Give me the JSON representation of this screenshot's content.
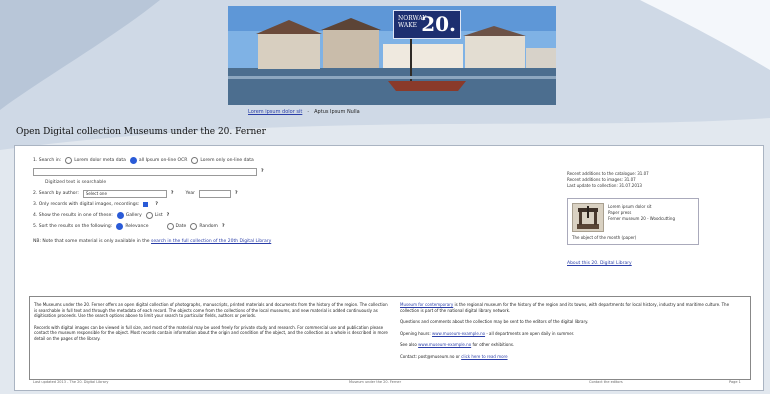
{
  "banner": {
    "badge_small": "NORWAY WAKE",
    "badge_big": "20.",
    "links": [
      "Lorem ipsum dolor sit",
      "Aptus Ipsum Nulla"
    ]
  },
  "page_title": "Open Digital collection Museums under the 20. Ferner",
  "form": {
    "search_label": "1. Search in:",
    "search_options": [
      "Lorem dolor meta data",
      "all Ipsum on-line OCR",
      "Lorem only on-line data"
    ],
    "search_help": "?",
    "search_note": "Digitized text is searchable",
    "author_label": "2. Search by author:",
    "author_select": "Select one",
    "year_label": "Year",
    "only_images_label": "3. Only records with digital images, recordings:",
    "display_label": "4. Show the results in one of these:",
    "display_options": [
      "Gallery",
      "List"
    ],
    "sort_label": "5. Sort the results on the following:",
    "sort_options": [
      "Relevance",
      "Date",
      "Random"
    ],
    "footnote_text": "NB: Note that some material is only available in the",
    "footnote_link": "search in the full collection of the 20th Digital Library"
  },
  "right": {
    "info_lines": [
      "Recent additions to the catalogue: 31.07",
      "Recent additions to images: 31.07",
      "Last update to collection: 31.07.2013"
    ],
    "thumb_lines": [
      "Lorem ipsum dolor sit",
      "Paper press",
      "Ferner museum 20 - Woodcutting"
    ],
    "thumb_caption": "The object of the month (paper)",
    "link": "About this 20. Digital Library"
  },
  "text": {
    "left_p1": "The Museums under the 20. Ferner offers an open digital collection of photographs, manuscripts, printed materials and documents from the history of the region. The collection is searchable in full text and through the metadata of each record. The objects come from the collections of the local museums, and new material is added continuously as digitisation proceeds. Use the search options above to limit your search to particular fields, authors or periods.",
    "left_p2": "Records with digital images can be viewed in full size, and most of the material may be used freely for private study and research. For commercial use and publication please contact the museum responsible for the object. Most records contain information about the origin and condition of the object, and the collection as a whole is described in more detail on the pages of the library.",
    "right_p1_link": "Museum for contemporary",
    "right_p1": "is the regional museum for the history of the region and its towns, with departments for local history, industry and maritime culture. The collection is part of the national digital library network.",
    "right_p2": "Questions and comments about the collection may be sent to the editors of the digital library.",
    "right_p3_pre": "Opening hours:",
    "right_p3_link": "www.museum-example.no",
    "right_p3": "- all departments are open daily in summer.",
    "right_p4_pre": "See also",
    "right_p4_link": "www.museum-example.no",
    "right_p4": "for other exhibitions.",
    "right_p5_pre": "Contact: post@museum.no or",
    "right_p5_link": "click here to read more"
  },
  "footer": {
    "left": "Last updated 2013 - The 20. Digital Library",
    "center": "Museum under the 20. Ferner",
    "right1": "Contact the editors",
    "right2": "Page 1"
  }
}
